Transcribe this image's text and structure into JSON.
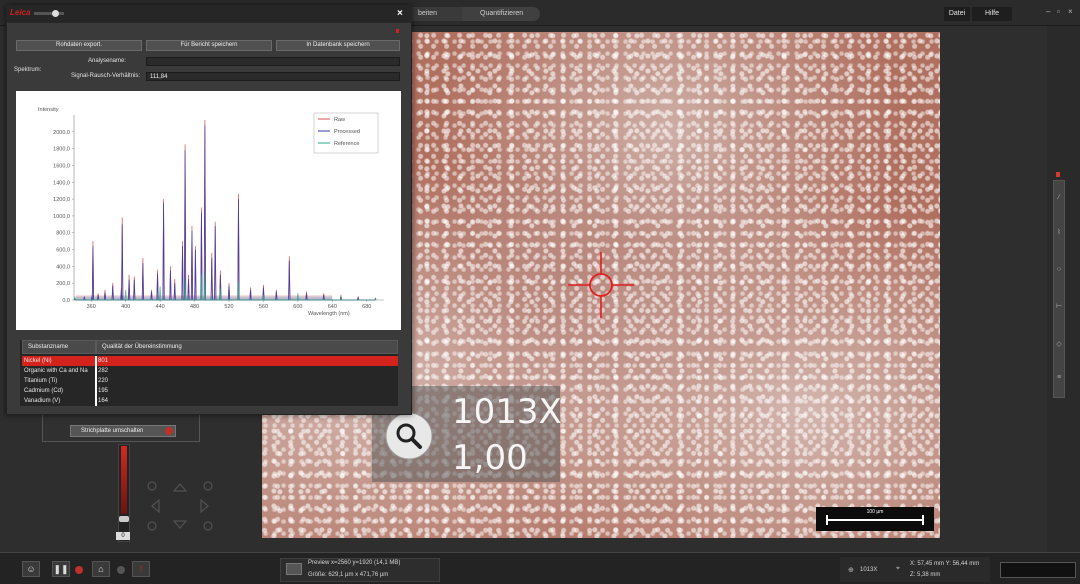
{
  "app": {
    "breadcrumbs": [
      "beiten",
      "Quantifizieren"
    ],
    "menu": {
      "file": "Datei",
      "help": "Hilfe"
    },
    "window_controls": [
      "–",
      "▫",
      "×"
    ]
  },
  "image_view": {
    "zoom_magnification": "1013X",
    "zoom_value": "1,00",
    "scale_bar_label": "100 µm"
  },
  "left_panel": {
    "reticle_button": "Strichplatte umschalten",
    "slider_value": "0"
  },
  "dialog": {
    "close_label": "×",
    "buttons": {
      "export_raw": "Rohdaten export.",
      "save_report": "Für Bericht speichern",
      "save_db": "In Datenbank speichern"
    },
    "spectrum_label": "Spektrum:",
    "analysis_name_label": "Analysename:",
    "analysis_name_value": "",
    "snr_label": "Signal-Rausch-Verhältnis:",
    "snr_value": "111,84",
    "table": {
      "headers": [
        "Substanzname",
        "Qualität der Übereinstimmung"
      ],
      "rows": [
        {
          "name": "Nickel (Ni)",
          "score": "801",
          "selected": true
        },
        {
          "name": "Organic with Ca and Na",
          "score": "282",
          "selected": false
        },
        {
          "name": "Titanium (Ti)",
          "score": "220",
          "selected": false
        },
        {
          "name": "Cadmium (Cd)",
          "score": "195",
          "selected": false
        },
        {
          "name": "Vanadium (V)",
          "score": "164",
          "selected": false
        }
      ]
    }
  },
  "status_bar": {
    "preview": "Preview x=2560 y=1920 (14,1 MB)",
    "size": "Größe: 629,1 µm x 471,76 µm",
    "zoom": "1013X",
    "coords": "X: 57,45 mm Y: 56,44 mm",
    "z": "Z: 5,38 mm"
  },
  "colors": {
    "accent": "#d4231c",
    "raw_series": "#d9534f",
    "processed_series": "#3a3aa8",
    "reference_series": "#2aa88a"
  },
  "chart_data": {
    "type": "line",
    "ylabel": "Intensity",
    "xlabel": "Wavelength (nm)",
    "xlim": [
      340,
      700
    ],
    "ylim": [
      0,
      2200
    ],
    "yticks": [
      0.0,
      200.0,
      400.0,
      600.0,
      800.0,
      1000.0,
      1200.0,
      1400.0,
      1600.0,
      1800.0,
      2000.0
    ],
    "ytick_labels": [
      "0,0",
      "200,0",
      "400,0",
      "600,0",
      "800,0",
      "1000,0",
      "1200,0",
      "1400,0",
      "1600,0",
      "1800,0",
      "2000,0"
    ],
    "xticks": [
      360,
      400,
      440,
      480,
      520,
      560,
      600,
      640,
      680
    ],
    "legend": [
      "Raw",
      "Processed",
      "Reference"
    ],
    "legend_position": "top-right",
    "series": [
      {
        "name": "Raw",
        "color": "#d9534f",
        "x": [
          341,
          352,
          361,
          362,
          368,
          376,
          385,
          395,
          396,
          404,
          410,
          420,
          430,
          437,
          444,
          452,
          457,
          466,
          469,
          473,
          477,
          481,
          488,
          492,
          500,
          504,
          510,
          520,
          531,
          545,
          560,
          575,
          590,
          610,
          630,
          650,
          670,
          690
        ],
        "y": [
          20,
          40,
          60,
          700,
          80,
          120,
          200,
          150,
          980,
          300,
          280,
          500,
          120,
          360,
          1200,
          400,
          250,
          700,
          1850,
          300,
          880,
          640,
          1100,
          2140,
          560,
          930,
          350,
          200,
          1260,
          150,
          180,
          120,
          520,
          100,
          80,
          60,
          40,
          20
        ]
      },
      {
        "name": "Processed",
        "color": "#3a3aa8",
        "x": [
          341,
          352,
          361,
          362,
          368,
          376,
          385,
          395,
          396,
          404,
          410,
          420,
          430,
          437,
          444,
          452,
          457,
          466,
          469,
          473,
          477,
          481,
          488,
          492,
          500,
          504,
          510,
          520,
          531,
          545,
          560,
          575,
          590,
          610,
          630,
          650,
          670,
          690
        ],
        "y": [
          10,
          30,
          50,
          640,
          60,
          90,
          170,
          120,
          900,
          240,
          240,
          440,
          100,
          320,
          1150,
          350,
          200,
          640,
          1780,
          250,
          820,
          600,
          1040,
          2080,
          500,
          880,
          300,
          170,
          1200,
          120,
          150,
          100,
          470,
          80,
          60,
          40,
          30,
          10
        ]
      },
      {
        "name": "Reference",
        "color": "#2aa88a",
        "x": [
          341,
          400,
          440,
          469,
          488,
          492,
          510,
          531,
          560,
          600,
          650,
          690
        ],
        "y": [
          30,
          120,
          160,
          260,
          300,
          340,
          140,
          220,
          60,
          80,
          40,
          20
        ]
      }
    ]
  }
}
